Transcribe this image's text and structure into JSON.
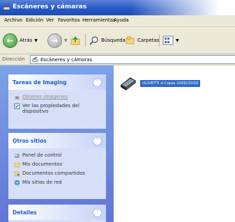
{
  "window": {
    "title": "Escáneres y cámaras"
  },
  "menu": [
    "Archivo",
    "Edición",
    "Ver",
    "Favoritos",
    "Herramientas",
    "Ayuda"
  ],
  "toolbar": {
    "back": "Atrás",
    "search": "Búsqueda",
    "folders": "Carpetas"
  },
  "address": {
    "label": "Dirección",
    "value": "Escáneres y cámaras"
  },
  "panels": {
    "imaging": {
      "title": "Tareas de Imaging",
      "tasks": [
        "Obtener imágenes",
        "Ver las propiedades del dispositivo"
      ]
    },
    "other": {
      "title": "Otros sitios",
      "links": [
        "Panel de control",
        "Mis documentos",
        "Documentos compartidos",
        "Mis sitios de red"
      ]
    },
    "details": {
      "title": "Detalles"
    }
  },
  "device": {
    "label": "OLIVETTI d-Copia 200D/201D"
  }
}
